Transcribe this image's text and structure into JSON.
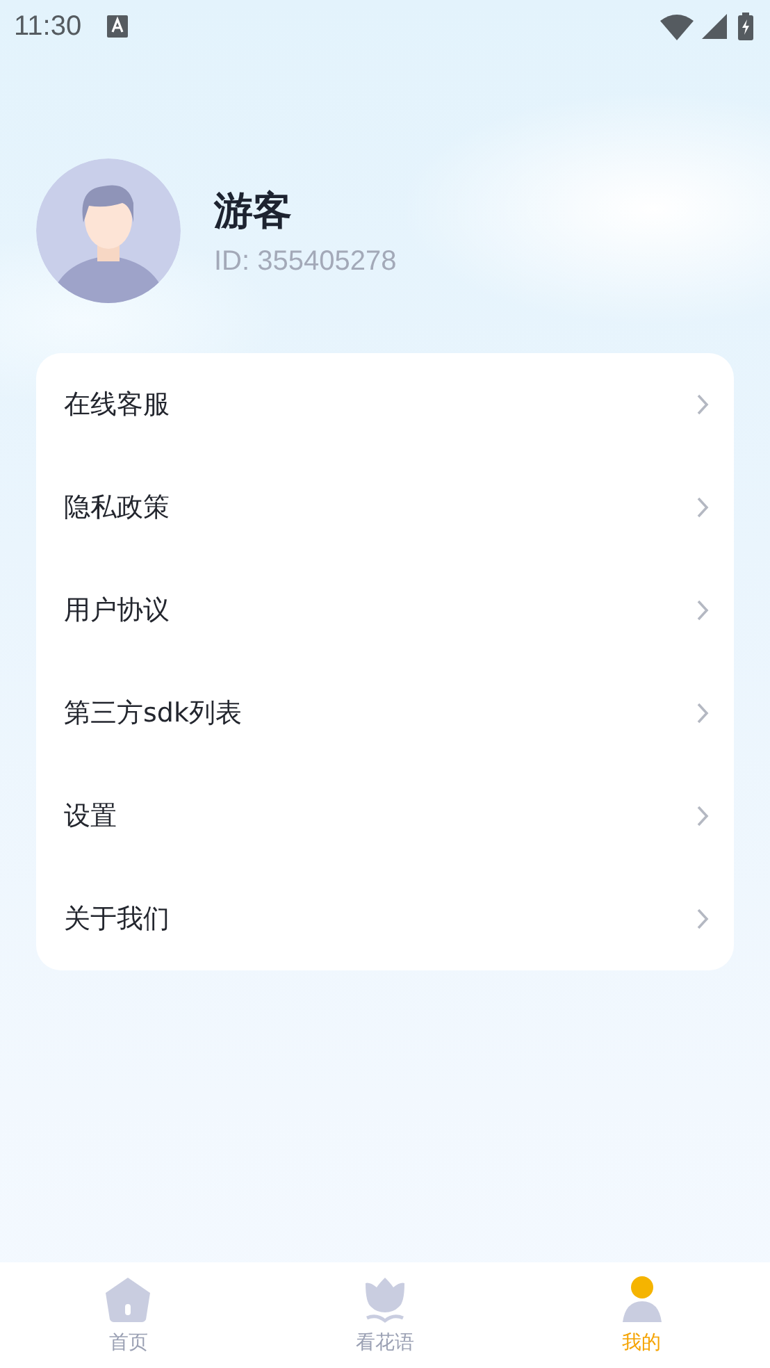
{
  "status_bar": {
    "time": "11:30"
  },
  "profile": {
    "name": "游客",
    "id": "ID: 355405278"
  },
  "menu": [
    {
      "label": "在线客服"
    },
    {
      "label": "隐私政策"
    },
    {
      "label": "用户协议"
    },
    {
      "label": "第三方sdk列表"
    },
    {
      "label": "设置"
    },
    {
      "label": "关于我们"
    }
  ],
  "tabs": [
    {
      "label": "首页",
      "kind": "home",
      "selected": false
    },
    {
      "label": "看花语",
      "kind": "flower",
      "selected": false
    },
    {
      "label": "我的",
      "kind": "me",
      "selected": true
    }
  ]
}
